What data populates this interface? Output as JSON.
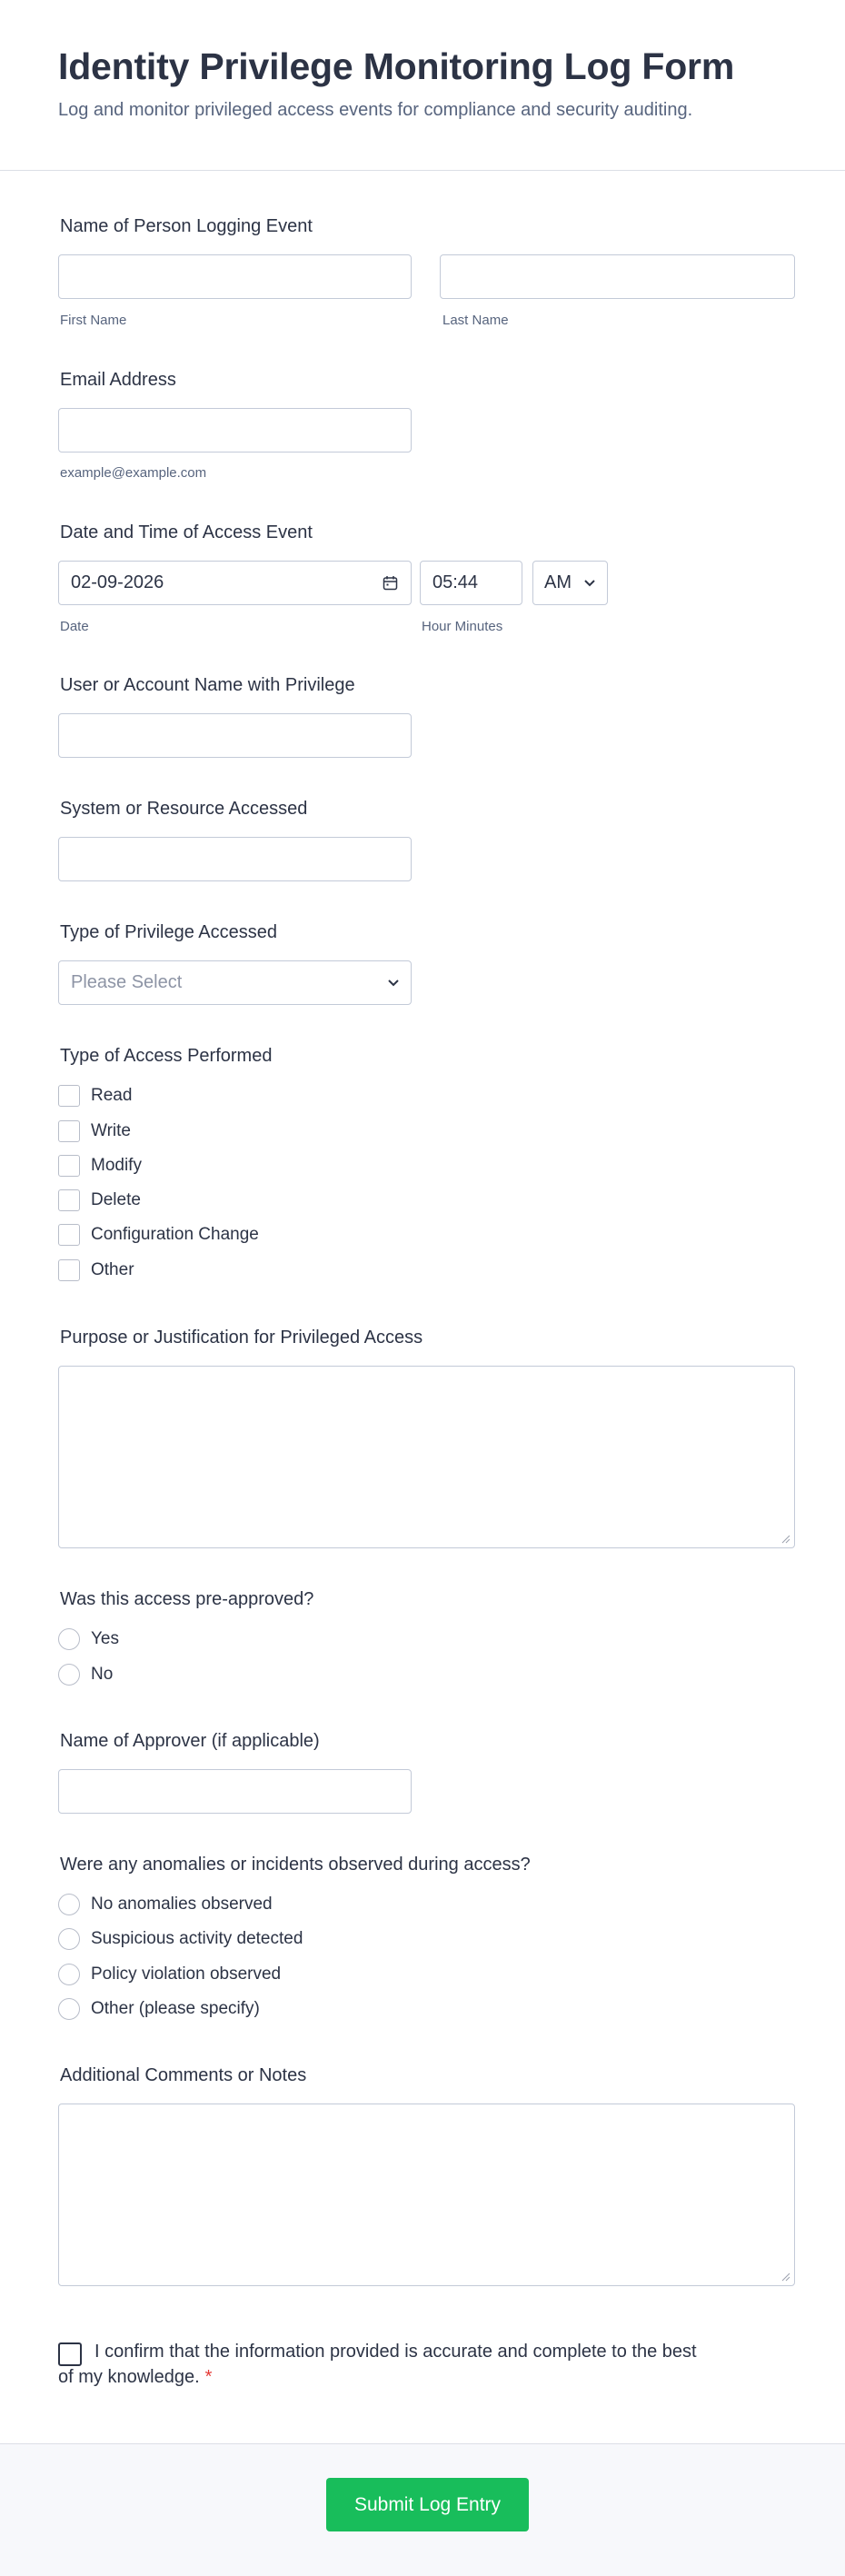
{
  "header": {
    "title": "Identity Privilege Monitoring Log Form",
    "subtitle": "Log and monitor privileged access events for compliance and security auditing."
  },
  "name_field": {
    "label": "Name of Person Logging Event",
    "first_value": "",
    "last_value": "",
    "first_sublabel": "First Name",
    "last_sublabel": "Last Name"
  },
  "email_field": {
    "label": "Email Address",
    "value": "",
    "sublabel": "example@example.com"
  },
  "datetime_field": {
    "label": "Date and Time of Access Event",
    "date_value": "02-09-2026",
    "time_value": "05:44",
    "ampm_value": "AM",
    "date_sublabel": "Date",
    "time_sublabel": "Hour Minutes"
  },
  "user_field": {
    "label": "User or Account Name with Privilege",
    "value": ""
  },
  "system_field": {
    "label": "System or Resource Accessed",
    "value": ""
  },
  "privilege_type": {
    "label": "Type of Privilege Accessed",
    "placeholder": "Please Select"
  },
  "access_type": {
    "label": "Type of Access Performed",
    "options": [
      "Read",
      "Write",
      "Modify",
      "Delete",
      "Configuration Change",
      "Other"
    ]
  },
  "purpose_field": {
    "label": "Purpose or Justification for Privileged Access",
    "value": ""
  },
  "preapproved": {
    "label": "Was this access pre-approved?",
    "options": [
      "Yes",
      "No"
    ]
  },
  "approver_field": {
    "label": "Name of Approver (if applicable)",
    "value": ""
  },
  "anomalies": {
    "label": "Were any anomalies or incidents observed during access?",
    "options": [
      "No anomalies observed",
      "Suspicious activity detected",
      "Policy violation observed",
      "Other (please specify)"
    ]
  },
  "comments_field": {
    "label": "Additional Comments or Notes",
    "value": ""
  },
  "confirmation": {
    "text": "I confirm that the information provided is accurate and complete to the best of my knowledge.",
    "required_mark": "*"
  },
  "submit": {
    "label": "Submit Log Entry"
  },
  "colors": {
    "accent": "#18bd5b",
    "required": "#e53935",
    "text": "#2c3345",
    "sublabel": "#57647e",
    "border": "#c3cad8"
  }
}
